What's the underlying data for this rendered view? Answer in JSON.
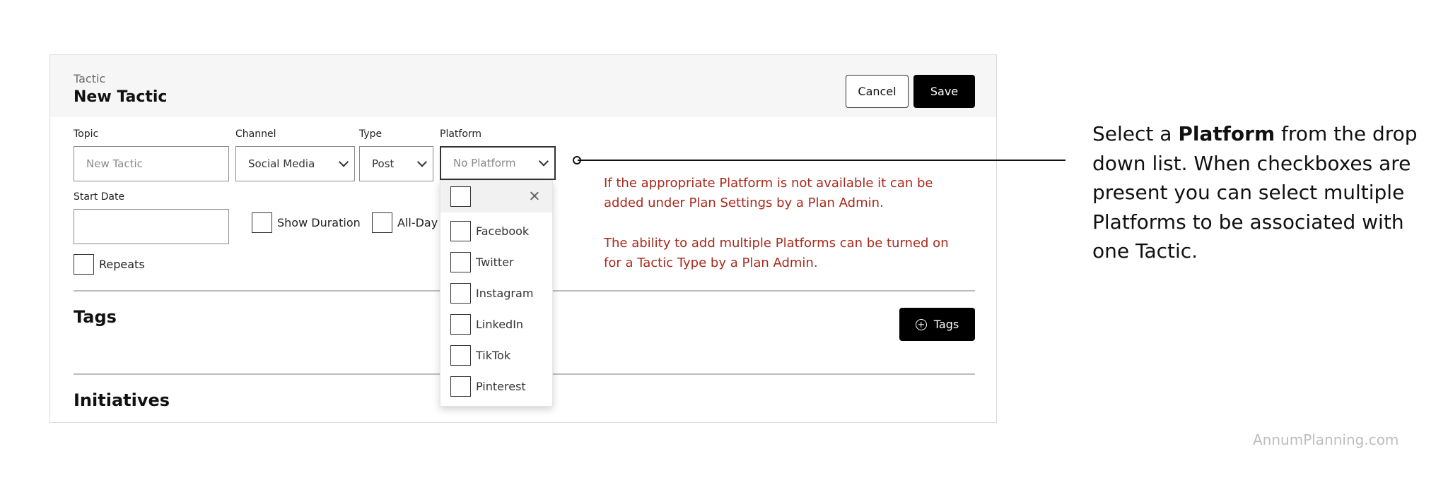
{
  "header": {
    "eyebrow": "Tactic",
    "title": "New Tactic",
    "cancel_label": "Cancel",
    "save_label": "Save"
  },
  "form": {
    "topic": {
      "label": "Topic",
      "placeholder": "New Tactic"
    },
    "channel": {
      "label": "Channel",
      "value": "Social Media"
    },
    "type": {
      "label": "Type",
      "value": "Post"
    },
    "platform": {
      "label": "Platform",
      "value": "No Platform"
    },
    "start_date": {
      "label": "Start Date",
      "value": ""
    },
    "show_duration_label": "Show Duration",
    "all_day_label": "All-Day",
    "repeats_label": "Repeats"
  },
  "platform_dropdown": {
    "options": [
      {
        "label": "Facebook",
        "checked": false
      },
      {
        "label": "Twitter",
        "checked": false
      },
      {
        "label": "Instagram",
        "checked": false
      },
      {
        "label": "LinkedIn",
        "checked": false
      },
      {
        "label": "TikTok",
        "checked": false
      },
      {
        "label": "Pinterest",
        "checked": false
      }
    ]
  },
  "sections": {
    "tags_title": "Tags",
    "tags_button_label": "Tags",
    "initiatives_title": "Initiatives"
  },
  "notes": {
    "note1": "If the appropriate Platform is not available it can be added under Plan Settings by a Plan Admin.",
    "note2": "The ability to add multiple Platforms can be turned on for a Tactic Type by a Plan Admin."
  },
  "callout": {
    "prefix": "Select a ",
    "emphasis": "Platform",
    "suffix": " from the drop down list. When checkboxes are present you can select multiple Platforms to be associated with one Tactic."
  },
  "brand": "AnnumPlanning.com",
  "colors": {
    "note_text": "#a82a1c",
    "primary_button": "#000000",
    "header_background": "#f6f6f6"
  }
}
